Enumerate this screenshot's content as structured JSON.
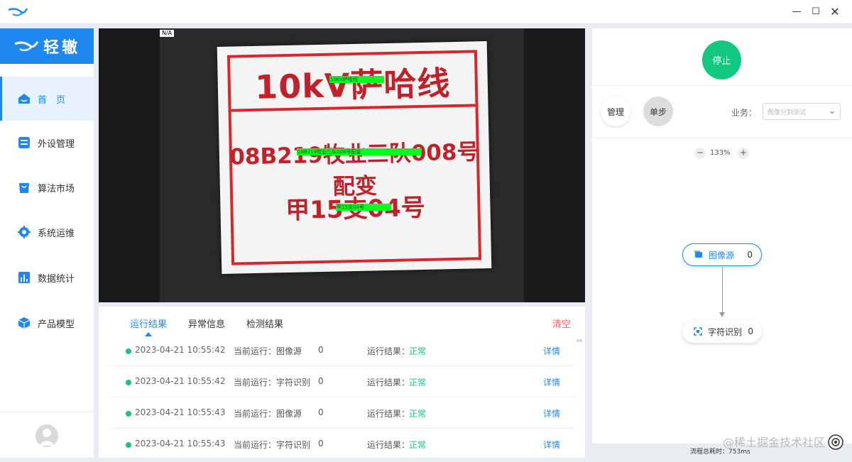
{
  "app": {
    "brand_name": "轻辙",
    "window_controls": [
      "minimize",
      "maximize",
      "close"
    ]
  },
  "sidebar": {
    "items": [
      {
        "label": "首　页",
        "icon": "home-icon",
        "active": true
      },
      {
        "label": "外设管理",
        "icon": "device-icon",
        "active": false
      },
      {
        "label": "算法市场",
        "icon": "market-icon",
        "active": false
      },
      {
        "label": "系统运维",
        "icon": "gear-icon",
        "active": false
      },
      {
        "label": "数据统计",
        "icon": "chart-icon",
        "active": false
      },
      {
        "label": "产品模型",
        "icon": "cube-icon",
        "active": false
      }
    ]
  },
  "viewer": {
    "na_label": "N/A",
    "sign_lines": [
      "10kV萨哈线",
      "08B219牧业三队008号配变",
      "甲15支04号"
    ],
    "ocr_results": [
      "10kV萨哈线",
      "08B219牧业三队008号配变",
      "甲15支04号"
    ]
  },
  "results": {
    "tabs": [
      "运行结果",
      "异常信息",
      "检测结果"
    ],
    "active_tab": 0,
    "clear_label": "清空",
    "rows": [
      {
        "time": "2023-04-21 10:55:42",
        "current": "当前运行：图像源",
        "num": "0",
        "result_label": "运行结果：",
        "result": "正常",
        "detail": "详情"
      },
      {
        "time": "2023-04-21 10:55:42",
        "current": "当前运行：字符识别",
        "num": "0",
        "result_label": "运行结果：",
        "result": "正常",
        "detail": "详情"
      },
      {
        "time": "2023-04-21 10:55:43",
        "current": "当前运行：图像源",
        "num": "0",
        "result_label": "运行结果：",
        "result": "正常",
        "detail": "详情"
      },
      {
        "time": "2023-04-21 10:55:43",
        "current": "当前运行：字符识别",
        "num": "0",
        "result_label": "运行结果：",
        "result": "正常",
        "detail": "详情"
      }
    ]
  },
  "right_panel": {
    "stop_label": "停止",
    "manage_label": "管理",
    "step_label": "单步",
    "business_label": "业务：",
    "business_value": "图像分割测试",
    "zoom": "133%",
    "nodes": [
      {
        "label": "图像源",
        "count": "0",
        "icon": "image-icon"
      },
      {
        "label": "字符识别",
        "count": "0",
        "icon": "ocr-icon"
      }
    ],
    "total_time_label": "流程总耗时：",
    "total_time_value": "753ms"
  },
  "watermark": "@稀土掘金技术社区",
  "colors": {
    "primary": "#1e88f0",
    "success": "#10c97e",
    "danger": "#f5605b",
    "sign_red": "#c0212a",
    "ocr_green": "#00ff1e"
  }
}
